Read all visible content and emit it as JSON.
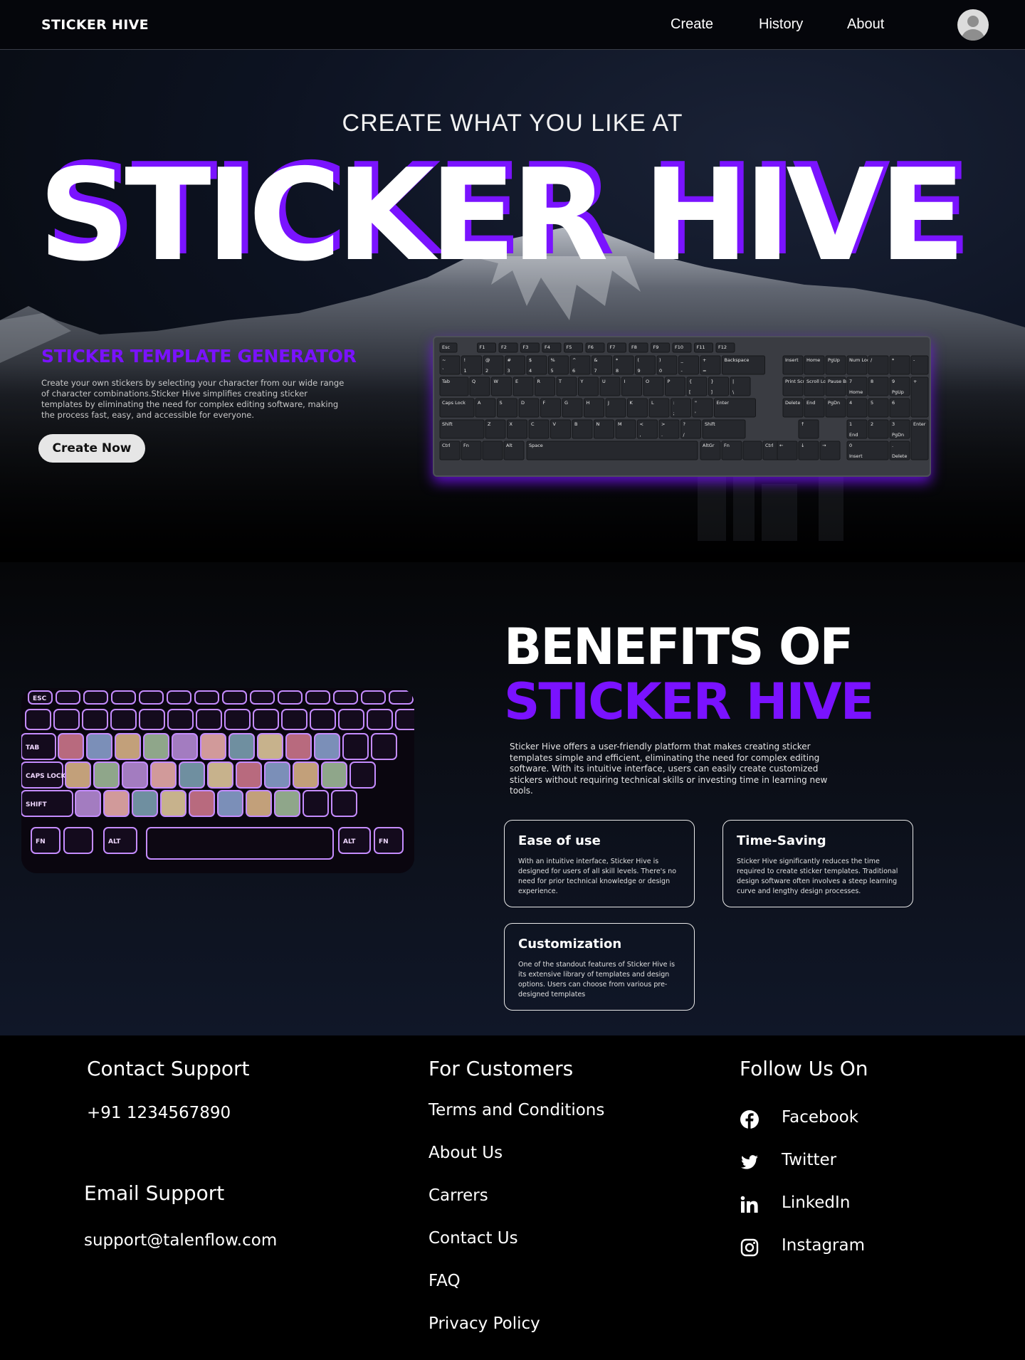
{
  "nav": {
    "logo": "STICKER HIVE",
    "links": [
      "Create",
      "History",
      "About"
    ]
  },
  "hero": {
    "eyebrow": "CREATE WHAT YOU LIKE AT",
    "title": "STICKER HIVE",
    "generator_title": "STICKER TEMPLATE  GENERATOR",
    "generator_desc": "Create your own stickers by selecting your character from our wide range of character combinations.Sticker Hive simplifies creating sticker templates by eliminating the need for complex editing software, making the process fast, easy, and accessible for everyone.",
    "cta": "Create Now"
  },
  "keyboard": {
    "row0": [
      "Esc",
      "F1",
      "F2",
      "F3",
      "F4",
      "F5",
      "F6",
      "F7",
      "F8",
      "F9",
      "F10",
      "F11",
      "F12"
    ],
    "row1": [
      "~",
      "!",
      "@",
      "#",
      "$",
      "%",
      "^",
      "&",
      "*",
      "(",
      ")",
      "_",
      "+",
      "Backspace"
    ],
    "row1b": [
      "`",
      "1",
      "2",
      "3",
      "4",
      "5",
      "6",
      "7",
      "8",
      "9",
      "0",
      "-",
      "="
    ],
    "row2": [
      "Tab",
      "Q",
      "W",
      "E",
      "R",
      "T",
      "Y",
      "U",
      "I",
      "O",
      "P",
      "{",
      "}",
      "|"
    ],
    "row2b": [
      "[",
      "]",
      "\\"
    ],
    "row3": [
      "Caps Lock",
      "A",
      "S",
      "D",
      "F",
      "G",
      "H",
      "J",
      "K",
      "L",
      ":",
      "\"",
      "Enter"
    ],
    "row3b": [
      ";",
      "'"
    ],
    "row4": [
      "Shift",
      "Z",
      "X",
      "C",
      "V",
      "B",
      "N",
      "M",
      "<",
      ">",
      "?",
      "Shift"
    ],
    "row4b": [
      ",",
      ".",
      "/"
    ],
    "row5": [
      "Ctrl",
      "Fn",
      "Alt",
      "Space",
      "AltGr",
      "Fn",
      "Ctrl"
    ],
    "nav_keys": [
      "Insert",
      "Home",
      "PgUp",
      "Print Screen",
      "Scroll Lock",
      "Pause Break",
      "Delete",
      "End",
      "PgDn"
    ],
    "numpad": [
      "Num Lock",
      "/",
      "*",
      "-",
      "7",
      "8",
      "9",
      "+",
      "Home",
      "PgUp",
      "4",
      "5",
      "6",
      "1",
      "2",
      "3",
      "End",
      "PgDn",
      "0",
      ".",
      "Enter",
      "Insert",
      "Delete"
    ],
    "arrows": [
      "↑",
      "←",
      "↓",
      "→"
    ]
  },
  "benefits": {
    "heading_line1": "BENEFITS OF",
    "heading_line2": "STICKER HIVE",
    "description": "Sticker Hive offers a user-friendly platform that makes creating sticker templates simple and efficient, eliminating the need for complex editing software. With its intuitive interface, users can easily create customized stickers without requiring technical skills or investing time in learning new tools.",
    "cards": [
      {
        "title": "Ease of use",
        "text": "With an intuitive interface, Sticker Hive is designed for users of all skill levels. There's no need for prior technical knowledge or design experience."
      },
      {
        "title": "Time-Saving",
        "text": "Sticker Hive significantly reduces the time required to create sticker templates. Traditional design software often involves a steep learning curve and lengthy design processes."
      },
      {
        "title": "Customization",
        "text": "One of the standout features of Sticker Hive is its extensive library of templates and design options. Users can choose from various pre-designed templates"
      }
    ],
    "photo_keys": [
      "ESC",
      "TAB",
      "CAPS LOCK",
      "SHIFT",
      "FN",
      "ALT",
      "ALT",
      "FN"
    ]
  },
  "footer": {
    "contact_heading": "Contact Support",
    "phone": "+91 1234567890",
    "email_heading": "Email Support",
    "email": "support@talenflow.com",
    "customers_heading": "For Customers",
    "customer_links": [
      "Terms and Conditions",
      "About Us",
      "Carrers",
      "Contact Us",
      "FAQ",
      "Privacy Policy"
    ],
    "follow_heading": "Follow Us On",
    "socials": [
      {
        "label": "Facebook",
        "icon": "facebook-icon"
      },
      {
        "label": "Twitter",
        "icon": "twitter-icon"
      },
      {
        "label": "LinkedIn",
        "icon": "linkedin-icon"
      },
      {
        "label": "Instagram",
        "icon": "instagram-icon"
      }
    ]
  },
  "colors": {
    "accent_purple": "#7a12ff",
    "background": "#000000",
    "hero_navy": "#0d1322",
    "button_bg": "#e6e6e6"
  }
}
